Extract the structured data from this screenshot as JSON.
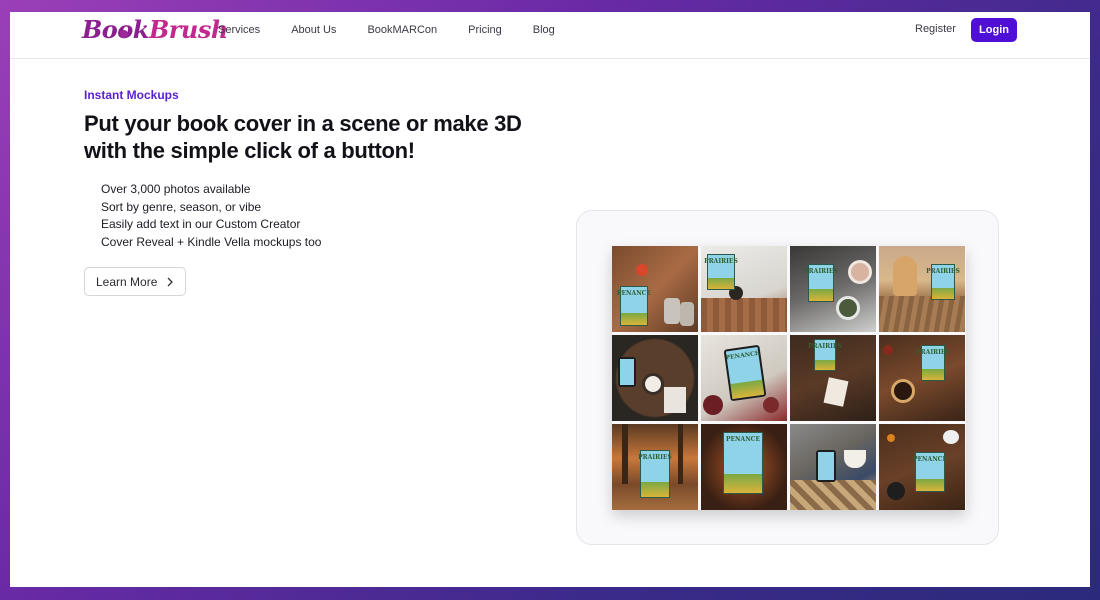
{
  "nav": {
    "logo_part1": "Book",
    "logo_part2": "Brush",
    "links": [
      "Services",
      "About Us",
      "BookMARCon",
      "Pricing",
      "Blog"
    ],
    "register": "Register",
    "login": "Login"
  },
  "hero": {
    "eyebrow": "Instant Mockups",
    "headline": "Put your book cover in a scene or make 3D with the simple click of a button!",
    "features": [
      "Over 3,000 photos available",
      "Sort by genre, season, or vibe",
      "Easily add text in our Custom Creator",
      "Cover Reveal + Kindle Vella mockups too"
    ],
    "cta": "Learn More"
  },
  "mockups": {
    "cover_title_top": "PENANCE",
    "cover_title_bottom": "PRAIRIES"
  },
  "colors": {
    "accent": "#4f0fd6",
    "eyebrow": "#5a1fd0",
    "logo": "#8c1f8f"
  }
}
